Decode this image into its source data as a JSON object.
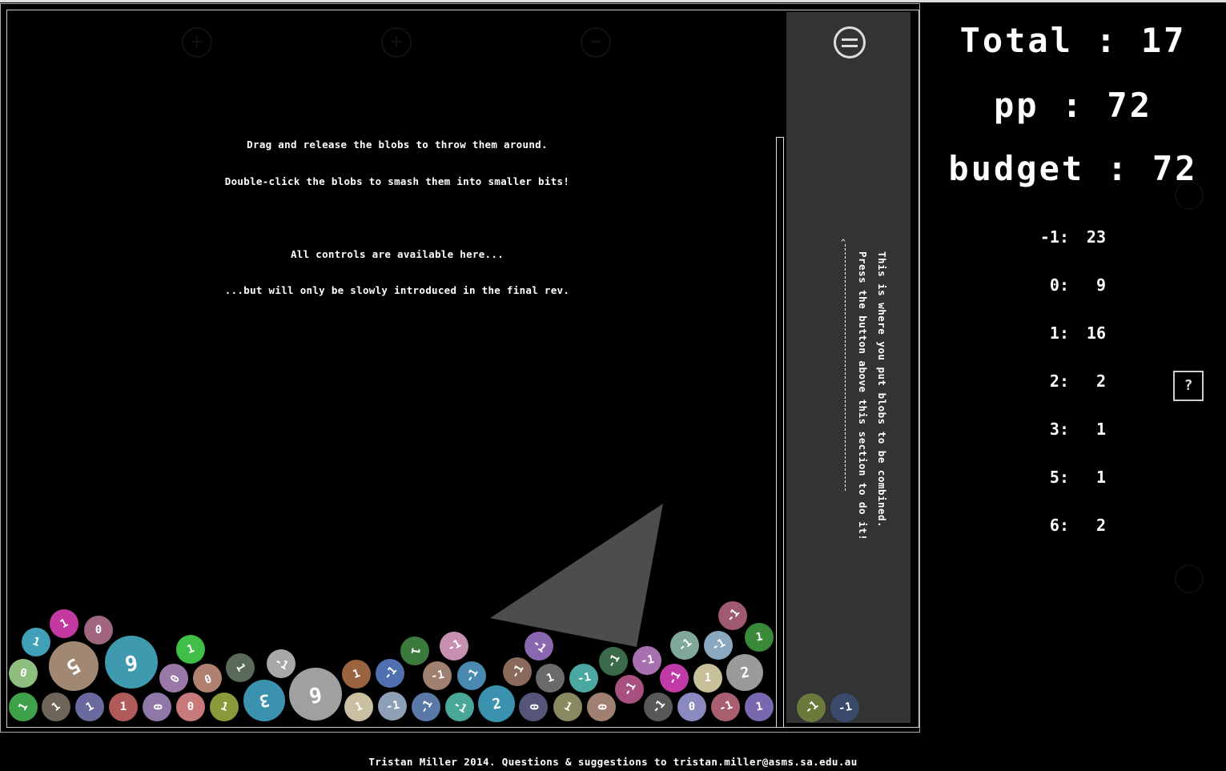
{
  "stats": {
    "total_label": "Total : 17",
    "pp_label": "pp : 72",
    "budget_label": "budget : 72",
    "counts": [
      {
        "key": "-1:",
        "value": "23"
      },
      {
        "key": "0:",
        "value": "9"
      },
      {
        "key": "1:",
        "value": "16"
      },
      {
        "key": "2:",
        "value": "2"
      },
      {
        "key": "3:",
        "value": "1"
      },
      {
        "key": "5:",
        "value": "1"
      },
      {
        "key": "6:",
        "value": "2"
      }
    ]
  },
  "instructions": {
    "line1": "Drag and release the blobs to throw them around.",
    "line2": "Double-click the blobs to smash them into smaller bits!",
    "line3": "All controls are available here...",
    "line4": "...but will only be slowly introduced in the final rev."
  },
  "combine": {
    "text1": "This is where you put blobs to be combined.",
    "text2": "Press the button above this section to do it!"
  },
  "help_label": "?",
  "ghost_buttons": [
    "+",
    "+",
    "−"
  ],
  "footer": "Tristan Miller 2014. Questions & suggestions to tristan.miller@asms.sa.edu.au",
  "blobs": [
    {
      "label": "1",
      "color": "#3fa24a"
    },
    {
      "label": "0",
      "color": "#8fbf7f"
    },
    {
      "label": "1",
      "color": "#3fa0b8"
    },
    {
      "label": "1",
      "color": "#c2399f"
    },
    {
      "label": "0",
      "color": "#a0667e"
    },
    {
      "label": "5",
      "color": "#a08872"
    },
    {
      "label": "6",
      "color": "#3f9ab0"
    },
    {
      "label": "1",
      "color": "#6e6558"
    },
    {
      "label": "1",
      "color": "#6a6a9e"
    },
    {
      "label": "1",
      "color": "#b05a5a"
    },
    {
      "label": "0",
      "color": "#8f78a8"
    },
    {
      "label": "0",
      "color": "#c87a7a"
    },
    {
      "label": "0",
      "color": "#9a78a8"
    },
    {
      "label": "1",
      "color": "#3fbf48"
    },
    {
      "label": "0",
      "color": "#b08070"
    },
    {
      "label": "1",
      "color": "#8a9a3a"
    },
    {
      "label": "1",
      "color": "#5a6a5a"
    },
    {
      "label": "3",
      "color": "#3a92ae"
    },
    {
      "label": "-1",
      "color": "#a8a8a8"
    },
    {
      "label": "6",
      "color": "#a0a0a0"
    },
    {
      "label": "1",
      "color": "#9a6440"
    },
    {
      "label": "1",
      "color": "#c8c0a0"
    },
    {
      "label": "-1",
      "color": "#5070b0"
    },
    {
      "label": "-1",
      "color": "#8ea0b8"
    },
    {
      "label": "1",
      "color": "#3a7a3a"
    },
    {
      "label": "-1",
      "color": "#a08070"
    },
    {
      "label": "-1",
      "color": "#c890b0"
    },
    {
      "label": "-1",
      "color": "#4a8ab0"
    },
    {
      "label": "-1",
      "color": "#5a78a8"
    },
    {
      "label": "-1",
      "color": "#4aa898"
    },
    {
      "label": "2",
      "color": "#3a92ae"
    },
    {
      "label": "-1",
      "color": "#8a6a5a"
    },
    {
      "label": "-1",
      "color": "#8a68b0"
    },
    {
      "label": "1",
      "color": "#6a6a6a"
    },
    {
      "label": "0",
      "color": "#55557a"
    },
    {
      "label": "1",
      "color": "#8a8a60"
    },
    {
      "label": "-1",
      "color": "#4aa8a0"
    },
    {
      "label": "0",
      "color": "#a08070"
    },
    {
      "label": "-1",
      "color": "#3a6a4a"
    },
    {
      "label": "-1",
      "color": "#a85080"
    },
    {
      "label": "-1",
      "color": "#585858"
    },
    {
      "label": "-1",
      "color": "#a870b0"
    },
    {
      "label": "-1",
      "color": "#c03aa8"
    },
    {
      "label": "0",
      "color": "#8a8ac0"
    },
    {
      "label": "-1",
      "color": "#80a898"
    },
    {
      "label": "-1",
      "color": "#8aa8c0"
    },
    {
      "label": "1",
      "color": "#c8c098"
    },
    {
      "label": "-1",
      "color": "#a86070"
    },
    {
      "label": "-1",
      "color": "#a05a70"
    },
    {
      "label": "2",
      "color": "#9a9a9a"
    },
    {
      "label": "1",
      "color": "#3a8a3a"
    },
    {
      "label": "1",
      "color": "#7868b0"
    }
  ],
  "combine_blobs": [
    {
      "label": "-1",
      "color": "#6a7a3a"
    },
    {
      "label": "-1",
      "color": "#3a4a6a"
    }
  ]
}
